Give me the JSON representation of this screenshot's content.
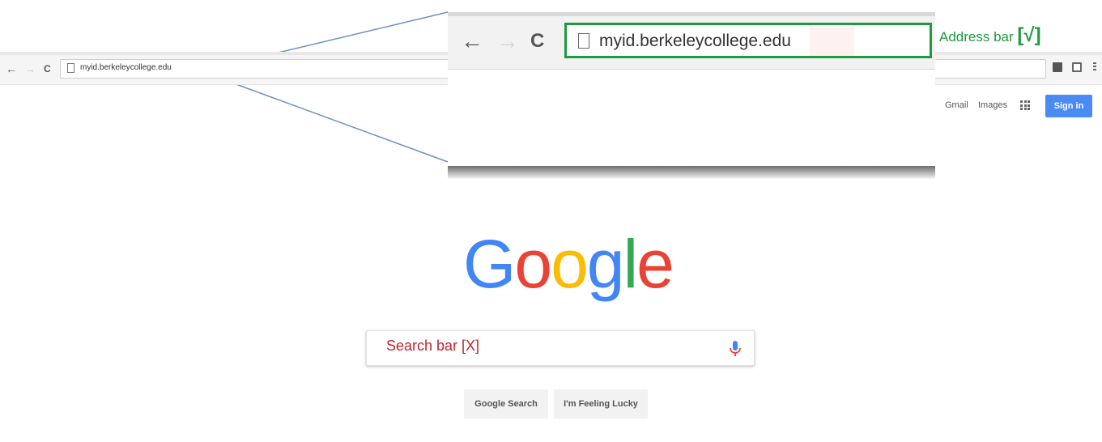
{
  "small_browser": {
    "back": "←",
    "forward": "→",
    "reload": "C",
    "url": "myid.berkeleycollege.edu"
  },
  "google": {
    "gmail": "Gmail",
    "images": "Images",
    "sign_in": "Sign in",
    "logo_letters": [
      "G",
      "o",
      "o",
      "g",
      "l",
      "e"
    ],
    "logo_colors": [
      "#4285f4",
      "#ea4335",
      "#fbbc05",
      "#4285f4",
      "#34a853",
      "#ea4335"
    ],
    "search_label": "Search bar [X]",
    "search_button": "Google Search",
    "lucky_button": "I'm Feeling Lucky"
  },
  "callout": {
    "back": "←",
    "forward": "→",
    "reload": "C",
    "url": "myid.berkeleycollege.edu",
    "label": "Address bar",
    "mark_open": "[",
    "mark_check": "√",
    "mark_close": "]",
    "highlight_color": "#1e9a3f",
    "error_color": "#c0262d"
  }
}
